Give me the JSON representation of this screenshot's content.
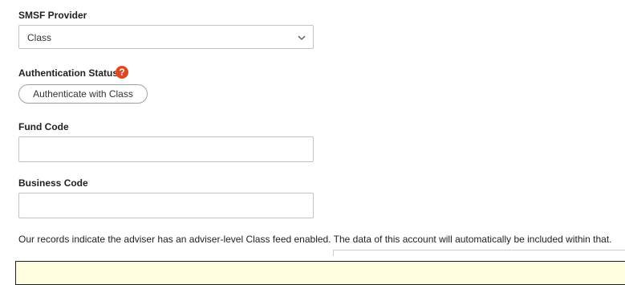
{
  "smsf_provider": {
    "label": "SMSF Provider",
    "selected": "Class",
    "icon": "chevron-down-icon"
  },
  "authentication": {
    "label": "Authentication Status",
    "help_glyph": "?",
    "help_icon": "help-icon",
    "help_color": "#e4451e",
    "button_label": "Authenticate with Class"
  },
  "fund_code": {
    "label": "Fund Code",
    "value": ""
  },
  "business_code": {
    "label": "Business Code",
    "value": ""
  },
  "notice": {
    "text": "Our records indicate the adviser has an adviser-level Class feed enabled. The data of this account will automatically be included within that."
  },
  "colors": {
    "warning_background": "#fffde0",
    "border": "#bcc3cc"
  }
}
